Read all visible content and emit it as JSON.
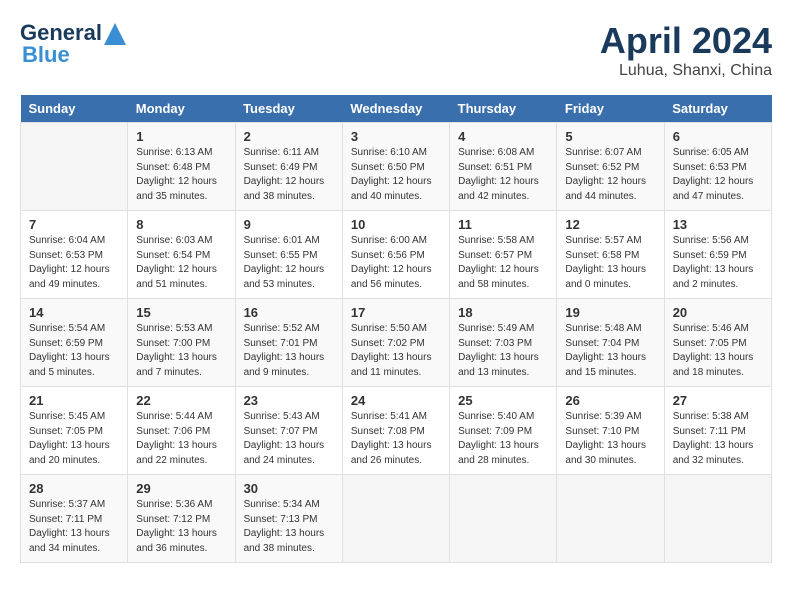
{
  "header": {
    "logo_general": "General",
    "logo_blue": "Blue",
    "month_year": "April 2024",
    "location": "Luhua, Shanxi, China"
  },
  "days_of_week": [
    "Sunday",
    "Monday",
    "Tuesday",
    "Wednesday",
    "Thursday",
    "Friday",
    "Saturday"
  ],
  "weeks": [
    [
      {
        "day": "",
        "sunrise": "",
        "sunset": "",
        "daylight": ""
      },
      {
        "day": "1",
        "sunrise": "Sunrise: 6:13 AM",
        "sunset": "Sunset: 6:48 PM",
        "daylight": "Daylight: 12 hours and 35 minutes."
      },
      {
        "day": "2",
        "sunrise": "Sunrise: 6:11 AM",
        "sunset": "Sunset: 6:49 PM",
        "daylight": "Daylight: 12 hours and 38 minutes."
      },
      {
        "day": "3",
        "sunrise": "Sunrise: 6:10 AM",
        "sunset": "Sunset: 6:50 PM",
        "daylight": "Daylight: 12 hours and 40 minutes."
      },
      {
        "day": "4",
        "sunrise": "Sunrise: 6:08 AM",
        "sunset": "Sunset: 6:51 PM",
        "daylight": "Daylight: 12 hours and 42 minutes."
      },
      {
        "day": "5",
        "sunrise": "Sunrise: 6:07 AM",
        "sunset": "Sunset: 6:52 PM",
        "daylight": "Daylight: 12 hours and 44 minutes."
      },
      {
        "day": "6",
        "sunrise": "Sunrise: 6:05 AM",
        "sunset": "Sunset: 6:53 PM",
        "daylight": "Daylight: 12 hours and 47 minutes."
      }
    ],
    [
      {
        "day": "7",
        "sunrise": "Sunrise: 6:04 AM",
        "sunset": "Sunset: 6:53 PM",
        "daylight": "Daylight: 12 hours and 49 minutes."
      },
      {
        "day": "8",
        "sunrise": "Sunrise: 6:03 AM",
        "sunset": "Sunset: 6:54 PM",
        "daylight": "Daylight: 12 hours and 51 minutes."
      },
      {
        "day": "9",
        "sunrise": "Sunrise: 6:01 AM",
        "sunset": "Sunset: 6:55 PM",
        "daylight": "Daylight: 12 hours and 53 minutes."
      },
      {
        "day": "10",
        "sunrise": "Sunrise: 6:00 AM",
        "sunset": "Sunset: 6:56 PM",
        "daylight": "Daylight: 12 hours and 56 minutes."
      },
      {
        "day": "11",
        "sunrise": "Sunrise: 5:58 AM",
        "sunset": "Sunset: 6:57 PM",
        "daylight": "Daylight: 12 hours and 58 minutes."
      },
      {
        "day": "12",
        "sunrise": "Sunrise: 5:57 AM",
        "sunset": "Sunset: 6:58 PM",
        "daylight": "Daylight: 13 hours and 0 minutes."
      },
      {
        "day": "13",
        "sunrise": "Sunrise: 5:56 AM",
        "sunset": "Sunset: 6:59 PM",
        "daylight": "Daylight: 13 hours and 2 minutes."
      }
    ],
    [
      {
        "day": "14",
        "sunrise": "Sunrise: 5:54 AM",
        "sunset": "Sunset: 6:59 PM",
        "daylight": "Daylight: 13 hours and 5 minutes."
      },
      {
        "day": "15",
        "sunrise": "Sunrise: 5:53 AM",
        "sunset": "Sunset: 7:00 PM",
        "daylight": "Daylight: 13 hours and 7 minutes."
      },
      {
        "day": "16",
        "sunrise": "Sunrise: 5:52 AM",
        "sunset": "Sunset: 7:01 PM",
        "daylight": "Daylight: 13 hours and 9 minutes."
      },
      {
        "day": "17",
        "sunrise": "Sunrise: 5:50 AM",
        "sunset": "Sunset: 7:02 PM",
        "daylight": "Daylight: 13 hours and 11 minutes."
      },
      {
        "day": "18",
        "sunrise": "Sunrise: 5:49 AM",
        "sunset": "Sunset: 7:03 PM",
        "daylight": "Daylight: 13 hours and 13 minutes."
      },
      {
        "day": "19",
        "sunrise": "Sunrise: 5:48 AM",
        "sunset": "Sunset: 7:04 PM",
        "daylight": "Daylight: 13 hours and 15 minutes."
      },
      {
        "day": "20",
        "sunrise": "Sunrise: 5:46 AM",
        "sunset": "Sunset: 7:05 PM",
        "daylight": "Daylight: 13 hours and 18 minutes."
      }
    ],
    [
      {
        "day": "21",
        "sunrise": "Sunrise: 5:45 AM",
        "sunset": "Sunset: 7:05 PM",
        "daylight": "Daylight: 13 hours and 20 minutes."
      },
      {
        "day": "22",
        "sunrise": "Sunrise: 5:44 AM",
        "sunset": "Sunset: 7:06 PM",
        "daylight": "Daylight: 13 hours and 22 minutes."
      },
      {
        "day": "23",
        "sunrise": "Sunrise: 5:43 AM",
        "sunset": "Sunset: 7:07 PM",
        "daylight": "Daylight: 13 hours and 24 minutes."
      },
      {
        "day": "24",
        "sunrise": "Sunrise: 5:41 AM",
        "sunset": "Sunset: 7:08 PM",
        "daylight": "Daylight: 13 hours and 26 minutes."
      },
      {
        "day": "25",
        "sunrise": "Sunrise: 5:40 AM",
        "sunset": "Sunset: 7:09 PM",
        "daylight": "Daylight: 13 hours and 28 minutes."
      },
      {
        "day": "26",
        "sunrise": "Sunrise: 5:39 AM",
        "sunset": "Sunset: 7:10 PM",
        "daylight": "Daylight: 13 hours and 30 minutes."
      },
      {
        "day": "27",
        "sunrise": "Sunrise: 5:38 AM",
        "sunset": "Sunset: 7:11 PM",
        "daylight": "Daylight: 13 hours and 32 minutes."
      }
    ],
    [
      {
        "day": "28",
        "sunrise": "Sunrise: 5:37 AM",
        "sunset": "Sunset: 7:11 PM",
        "daylight": "Daylight: 13 hours and 34 minutes."
      },
      {
        "day": "29",
        "sunrise": "Sunrise: 5:36 AM",
        "sunset": "Sunset: 7:12 PM",
        "daylight": "Daylight: 13 hours and 36 minutes."
      },
      {
        "day": "30",
        "sunrise": "Sunrise: 5:34 AM",
        "sunset": "Sunset: 7:13 PM",
        "daylight": "Daylight: 13 hours and 38 minutes."
      },
      {
        "day": "",
        "sunrise": "",
        "sunset": "",
        "daylight": ""
      },
      {
        "day": "",
        "sunrise": "",
        "sunset": "",
        "daylight": ""
      },
      {
        "day": "",
        "sunrise": "",
        "sunset": "",
        "daylight": ""
      },
      {
        "day": "",
        "sunrise": "",
        "sunset": "",
        "daylight": ""
      }
    ]
  ]
}
